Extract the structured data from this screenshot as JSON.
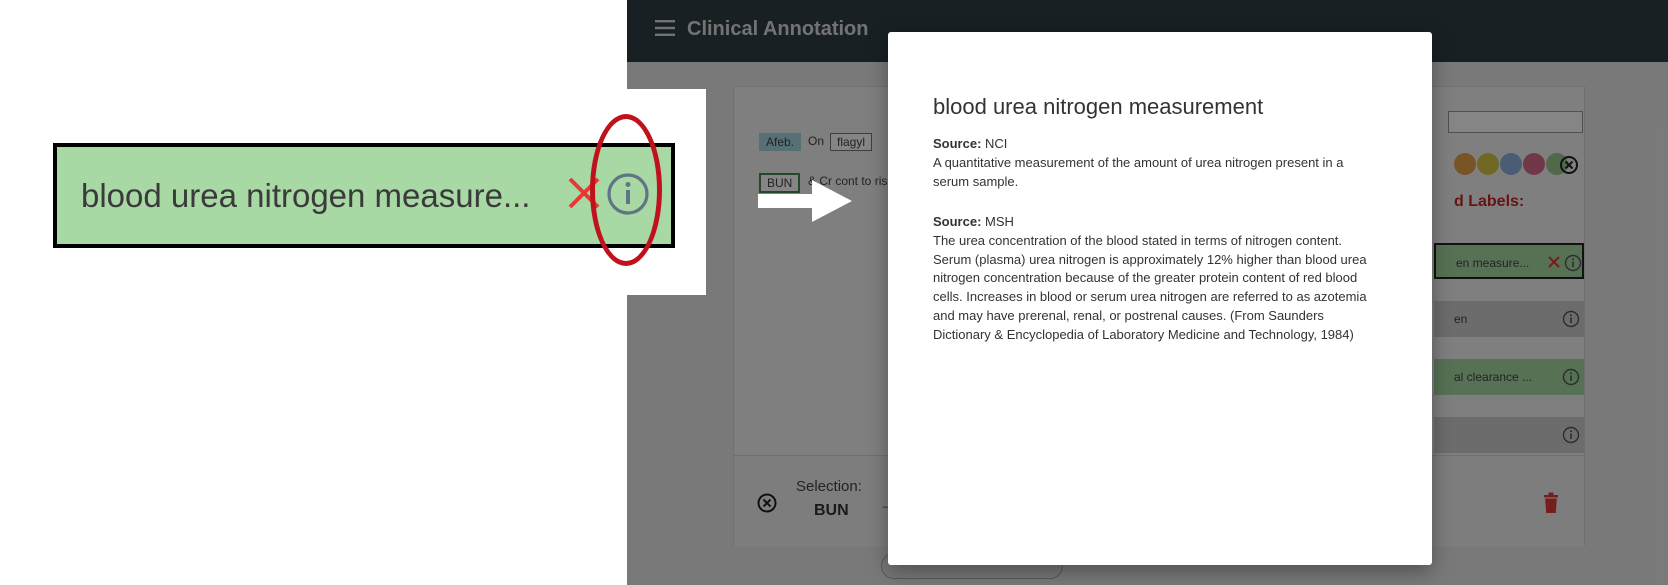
{
  "zoom": {
    "chip_label": "blood urea nitrogen measure..."
  },
  "app": {
    "title": "Clinical Annotation",
    "tokens": {
      "afeb": "Afeb.",
      "on": "On",
      "flagyl": "flagyl",
      "bun": "BUN",
      "cont": "& Cr cont to ris"
    },
    "labels_heading": "d Labels:",
    "label_chips": [
      {
        "text": "en measure..."
      },
      {
        "text": "en"
      },
      {
        "text": "al clearance ..."
      },
      {
        "text": ""
      }
    ],
    "selection": {
      "label": "Selection:",
      "value": "BUN"
    }
  },
  "dialog": {
    "title": "blood urea nitrogen measurement",
    "sources": [
      {
        "prefix": "Source:",
        "name": "NCI",
        "description": "A quantitative measurement of the amount of urea nitrogen present in a serum sample."
      },
      {
        "prefix": "Source:",
        "name": "MSH",
        "description": "The urea concentration of the blood stated in terms of nitrogen content. Serum (plasma) urea nitrogen is approximately 12% higher than blood urea nitrogen concentration because of the greater protein content of red blood cells. Increases in blood or serum urea nitrogen are referred to as azotemia and may have prerenal, renal, or postrenal causes. (From Saunders Dictionary & Encyclopedia of Laboratory Medicine and Technology, 1984)"
      }
    ]
  },
  "colors": {
    "appbar": "#2e3e46",
    "chip_green": "#a8d8a4",
    "chip_grey": "#cfcfcf",
    "highlight_red": "#c0121c",
    "accent_red": "#e53935",
    "info_icon": "#5f7583"
  },
  "icons": {
    "menu": "menu-icon",
    "close": "close-icon",
    "info": "info-icon",
    "clear": "clear-circle-icon",
    "trash": "trash-icon",
    "arrow": "right-arrow-icon"
  }
}
